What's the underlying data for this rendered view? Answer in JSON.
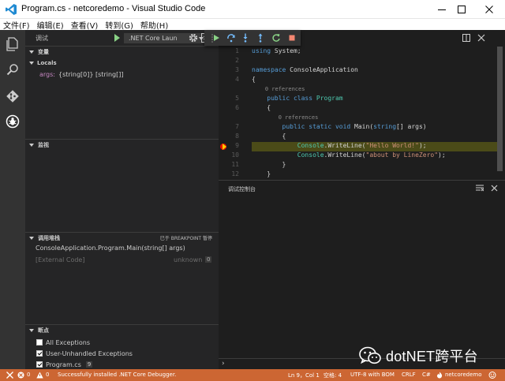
{
  "window": {
    "title": "Program.cs - netcoredemo - Visual Studio Code",
    "minimize_glyph": "—",
    "maximize_glyph": "☐",
    "close_glyph": "✕"
  },
  "menu": [
    "文件(F)",
    "编辑(E)",
    "查看(V)",
    "转到(G)",
    "帮助(H)"
  ],
  "activity_bar": [
    {
      "icon": "explorer-icon"
    },
    {
      "icon": "search-icon"
    },
    {
      "icon": "git-icon"
    },
    {
      "icon": "debug-icon"
    }
  ],
  "debug": {
    "view_label": "调试",
    "config": ".NET Core Laun",
    "toolbar": [
      {
        "icon": "continue-icon"
      },
      {
        "icon": "step-over-icon"
      },
      {
        "icon": "step-into-icon"
      },
      {
        "icon": "step-out-icon"
      },
      {
        "icon": "restart-icon"
      },
      {
        "icon": "stop-icon"
      }
    ]
  },
  "variables": {
    "header": "变量",
    "scope": "Locals",
    "items": [
      {
        "name": "args:",
        "value": "{string[0]} [string[]]"
      }
    ]
  },
  "watch": {
    "header": "监视"
  },
  "call_stack": {
    "header": "调用堆栈",
    "status": "已于 BREAKPOINT 暂停",
    "frames": [
      {
        "name": "ConsoleApplication.Program.Main(string[] args)",
        "dim": false
      },
      {
        "name": "[External Code]",
        "location": "unknown",
        "badge": "0",
        "dim": true
      }
    ]
  },
  "breakpoints": {
    "header": "断点",
    "items": [
      {
        "label": "All Exceptions",
        "checked": false
      },
      {
        "label": "User-Unhandled Exceptions",
        "checked": true
      },
      {
        "label": "Program.cs",
        "checked": true,
        "badge": "9"
      }
    ]
  },
  "editor": {
    "current_line": 9,
    "lines": [
      {
        "n": "1",
        "parts": [
          [
            "kw",
            "using"
          ],
          [
            "",
            " System;"
          ]
        ]
      },
      {
        "n": "2",
        "parts": []
      },
      {
        "n": "3",
        "parts": [
          [
            "kw",
            "namespace"
          ],
          [
            "",
            " ConsoleApplication"
          ]
        ]
      },
      {
        "n": "4",
        "parts": [
          [
            "",
            "{"
          ]
        ]
      },
      {
        "lens": "0 references",
        "indent": "    "
      },
      {
        "n": "5",
        "parts": [
          [
            "",
            "    "
          ],
          [
            "kw",
            "public class"
          ],
          [
            "",
            " "
          ],
          [
            "ty",
            "Program"
          ]
        ]
      },
      {
        "n": "6",
        "parts": [
          [
            "",
            "    {"
          ]
        ]
      },
      {
        "lens": "0 references",
        "indent": "        "
      },
      {
        "n": "7",
        "parts": [
          [
            "",
            "        "
          ],
          [
            "kw",
            "public static void"
          ],
          [
            "",
            " Main("
          ],
          [
            "kw",
            "string"
          ],
          [
            "",
            "[] args)"
          ]
        ]
      },
      {
        "n": "8",
        "parts": [
          [
            "",
            "        {"
          ]
        ]
      },
      {
        "n": "9",
        "parts": [
          [
            "",
            "            "
          ],
          [
            "ty",
            "Console"
          ],
          [
            "",
            ".WriteLine("
          ],
          [
            "str",
            "\"Hello World!\""
          ],
          [
            "",
            ");"
          ]
        ]
      },
      {
        "n": "10",
        "parts": [
          [
            "",
            "            "
          ],
          [
            "ty",
            "Console"
          ],
          [
            "",
            ".WriteLine("
          ],
          [
            "str",
            "\"about by LineZero\""
          ],
          [
            "",
            ");"
          ]
        ]
      },
      {
        "n": "11",
        "parts": [
          [
            "",
            "        }"
          ]
        ]
      },
      {
        "n": "12",
        "parts": [
          [
            "",
            "    }"
          ]
        ]
      }
    ]
  },
  "console": {
    "title": "调试控制台",
    "prompt": "›"
  },
  "status": {
    "errors": "0",
    "warnings": "0",
    "message": "Successfully installed .NET Core Debugger.",
    "position": "Ln 9，Col 1",
    "indent": "空格: 4",
    "encoding": "UTF-8 with BOM",
    "eol": "CRLF",
    "language": "C#",
    "project": "netcoredemo",
    "color": "#cc6633"
  },
  "watermark": {
    "text": "dotNET跨平台"
  }
}
